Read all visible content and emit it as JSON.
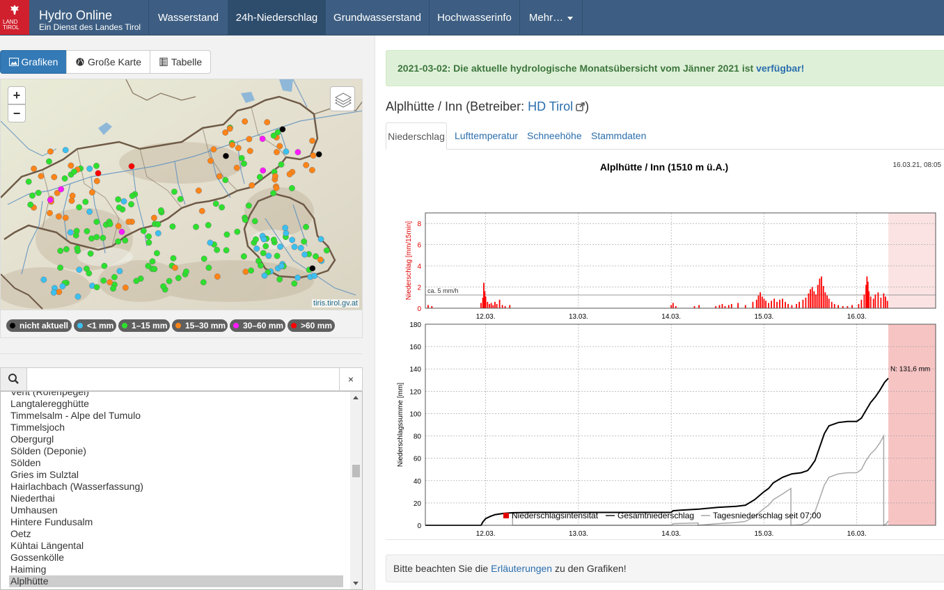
{
  "brand": {
    "logo_text": "LAND TIROL",
    "title": "Hydro Online",
    "subtitle": "Ein Dienst des Landes Tirol"
  },
  "nav": {
    "items": [
      {
        "label": "Wasserstand",
        "active": false
      },
      {
        "label": "24h-Niederschlag",
        "active": true
      },
      {
        "label": "Grundwasserstand",
        "active": false
      },
      {
        "label": "Hochwasserinfo",
        "active": false
      },
      {
        "label": "Mehr…",
        "active": false,
        "dropdown": true
      }
    ]
  },
  "view_buttons": [
    {
      "label": "Grafiken",
      "icon": "image-icon",
      "active": true
    },
    {
      "label": "Große Karte",
      "icon": "globe-icon",
      "active": false
    },
    {
      "label": "Tabelle",
      "icon": "table-icon",
      "active": false
    }
  ],
  "map": {
    "zoom_in": "+",
    "zoom_out": "−",
    "attribution": "tiris.tirol.gv.at",
    "legend": [
      {
        "label": "nicht aktuell",
        "color": "#000000"
      },
      {
        "label": "<1 mm",
        "color": "#3cc0f0"
      },
      {
        "label": "1–15 mm",
        "color": "#2ee02e"
      },
      {
        "label": "15–30 mm",
        "color": "#ff8418"
      },
      {
        "label": "30–60 mm",
        "color": "#ff19ff"
      },
      {
        "label": ">60 mm",
        "color": "#ff0000"
      }
    ]
  },
  "search": {
    "value": "",
    "placeholder": "",
    "clear": "×"
  },
  "stations": [
    "Vent (Rofenpegel)",
    "Langtaleregghütte",
    "Timmelsalm - Alpe del Tumulo",
    "Timmelsjoch",
    "Obergurgl",
    "Sölden (Deponie)",
    "Sölden",
    "Gries im Sulztal",
    "Hairlachbach (Wasserfassung)",
    "Niederthai",
    "Umhausen",
    "Hintere Fundusalm",
    "Oetz",
    "Kühtai Längental",
    "Gossenkölle",
    "Haiming",
    "Alplhütte"
  ],
  "selected_station": "Alplhütte",
  "alert": {
    "text": "2021-03-02: Die aktuelle hydrologische Monatsübersicht vom Jänner 2021 ist ",
    "link": "verfügbar!"
  },
  "station": {
    "title_prefix": "Alplhütte / Inn (Betreiber: ",
    "operator": "HD Tirol",
    "title_suffix": ")"
  },
  "tabs": [
    {
      "label": "Niederschlag",
      "active": true
    },
    {
      "label": "Lufttemperatur",
      "active": false
    },
    {
      "label": "Schneehöhe",
      "active": false
    },
    {
      "label": "Stammdaten",
      "active": false
    }
  ],
  "chart_data": [
    {
      "type": "bar",
      "title": "Alplhütte / Inn (1510 m ü.A.)",
      "timestamp": "16.03.21, 08:05",
      "ylabel": "Niederschlag [mm/15min]",
      "ylim": [
        0,
        9
      ],
      "yticks": [
        0,
        2,
        4,
        6,
        8
      ],
      "xticks": [
        "12.03.",
        "13.03.",
        "14.03.",
        "15.03.",
        "16.03."
      ],
      "xlim_days": [
        11.35,
        16.85
      ],
      "forecast_from_day": 16.34,
      "reference_line": {
        "value": 1.25,
        "label": "ca. 5 mm/h"
      },
      "series": [
        {
          "name": "Niederschlagsintensität",
          "color": "#ff0000",
          "points": [
            [
              11.38,
              0.3
            ],
            [
              11.42,
              0.2
            ],
            [
              11.95,
              0.5
            ],
            [
              11.97,
              1.0
            ],
            [
              11.98,
              2.4
            ],
            [
              11.99,
              1.6
            ],
            [
              12.0,
              1.1
            ],
            [
              12.02,
              0.6
            ],
            [
              12.04,
              0.4
            ],
            [
              12.06,
              0.5
            ],
            [
              12.08,
              0.3
            ],
            [
              12.1,
              0.6
            ],
            [
              12.12,
              0.4
            ],
            [
              12.15,
              0.8
            ],
            [
              12.18,
              0.3
            ],
            [
              12.21,
              0.2
            ],
            [
              12.26,
              0.3
            ],
            [
              14.0,
              0.3
            ],
            [
              14.02,
              0.5
            ],
            [
              14.05,
              0.2
            ],
            [
              14.25,
              0.2
            ],
            [
              14.3,
              0.3
            ],
            [
              14.48,
              0.2
            ],
            [
              14.52,
              0.3
            ],
            [
              14.55,
              0.4
            ],
            [
              14.58,
              0.2
            ],
            [
              14.62,
              0.3
            ],
            [
              14.65,
              0.4
            ],
            [
              14.72,
              0.5
            ],
            [
              14.8,
              0.3
            ],
            [
              14.88,
              0.6
            ],
            [
              14.92,
              0.8
            ],
            [
              14.94,
              1.2
            ],
            [
              14.96,
              1.5
            ],
            [
              14.98,
              1.1
            ],
            [
              15.0,
              0.9
            ],
            [
              15.02,
              0.7
            ],
            [
              15.05,
              0.5
            ],
            [
              15.08,
              0.7
            ],
            [
              15.11,
              0.9
            ],
            [
              15.14,
              0.6
            ],
            [
              15.17,
              0.8
            ],
            [
              15.2,
              0.9
            ],
            [
              15.23,
              0.6
            ],
            [
              15.26,
              0.4
            ],
            [
              15.3,
              0.3
            ],
            [
              15.35,
              0.4
            ],
            [
              15.38,
              0.6
            ],
            [
              15.42,
              0.8
            ],
            [
              15.45,
              1.0
            ],
            [
              15.48,
              1.4
            ],
            [
              15.5,
              1.8
            ],
            [
              15.52,
              2.0
            ],
            [
              15.54,
              1.6
            ],
            [
              15.56,
              1.3
            ],
            [
              15.58,
              2.2
            ],
            [
              15.6,
              2.8
            ],
            [
              15.62,
              3.0
            ],
            [
              15.64,
              2.1
            ],
            [
              15.66,
              1.5
            ],
            [
              15.68,
              1.2
            ],
            [
              15.7,
              0.9
            ],
            [
              15.73,
              0.6
            ],
            [
              15.76,
              0.4
            ],
            [
              15.8,
              0.3
            ],
            [
              15.85,
              0.2
            ],
            [
              15.9,
              0.2
            ],
            [
              15.95,
              0.3
            ],
            [
              16.02,
              0.4
            ],
            [
              16.05,
              0.8
            ],
            [
              16.08,
              1.3
            ],
            [
              16.1,
              2.2
            ],
            [
              16.11,
              3.0
            ],
            [
              16.12,
              2.5
            ],
            [
              16.13,
              1.6
            ],
            [
              16.15,
              1.1
            ],
            [
              16.18,
              0.9
            ],
            [
              16.2,
              1.3
            ],
            [
              16.23,
              1.5
            ],
            [
              16.26,
              1.0
            ],
            [
              16.29,
              1.4
            ],
            [
              16.31,
              1.1
            ],
            [
              16.33,
              0.7
            ]
          ]
        }
      ]
    },
    {
      "type": "line",
      "ylabel": "Niederschlagssumme [mm]",
      "ylim": [
        0,
        180
      ],
      "yticks": [
        0,
        20,
        40,
        60,
        80,
        100,
        120,
        140,
        160,
        180
      ],
      "xticks": [
        "12.03.",
        "13.03.",
        "14.03.",
        "15.03.",
        "16.03."
      ],
      "xlim_days": [
        11.35,
        16.85
      ],
      "forecast_from_day": 16.34,
      "end_label": "N: 131,6 mm",
      "series": [
        {
          "name": "Gesamtniederschlag",
          "color": "#000000",
          "points": [
            [
              11.35,
              0
            ],
            [
              11.95,
              0
            ],
            [
              11.97,
              3
            ],
            [
              12.0,
              6
            ],
            [
              12.05,
              8
            ],
            [
              12.1,
              9.5
            ],
            [
              12.2,
              10.8
            ],
            [
              12.3,
              11.3
            ],
            [
              12.5,
              11.5
            ],
            [
              13.0,
              11.5
            ],
            [
              13.5,
              11.5
            ],
            [
              14.0,
              11.6
            ],
            [
              14.02,
              13
            ],
            [
              14.1,
              13.5
            ],
            [
              14.3,
              14.5
            ],
            [
              14.5,
              16
            ],
            [
              14.7,
              17
            ],
            [
              14.8,
              18
            ],
            [
              14.9,
              23
            ],
            [
              15.0,
              30
            ],
            [
              15.05,
              33
            ],
            [
              15.1,
              38
            ],
            [
              15.2,
              43
            ],
            [
              15.3,
              46
            ],
            [
              15.4,
              47
            ],
            [
              15.47,
              49
            ],
            [
              15.5,
              52
            ],
            [
              15.55,
              58
            ],
            [
              15.6,
              70
            ],
            [
              15.65,
              82
            ],
            [
              15.7,
              89
            ],
            [
              15.8,
              92
            ],
            [
              15.9,
              93
            ],
            [
              16.0,
              93
            ],
            [
              16.05,
              96
            ],
            [
              16.1,
              103
            ],
            [
              16.15,
              110
            ],
            [
              16.2,
              115
            ],
            [
              16.25,
              121
            ],
            [
              16.3,
              128
            ],
            [
              16.34,
              131.6
            ]
          ]
        },
        {
          "name": "Tagesniederschlag seit 07:00",
          "color": "#a8a8a8",
          "points": [
            [
              11.35,
              0
            ],
            [
              11.95,
              0
            ],
            [
              11.97,
              3
            ],
            [
              12.0,
              6
            ],
            [
              12.05,
              8
            ],
            [
              12.1,
              9.5
            ],
            [
              12.2,
              10.8
            ],
            [
              12.29,
              11.2
            ],
            [
              12.29,
              0
            ],
            [
              14.0,
              0
            ],
            [
              14.02,
              1.5
            ],
            [
              14.29,
              2.1
            ],
            [
              14.29,
              0
            ],
            [
              14.5,
              1.5
            ],
            [
              14.7,
              2.5
            ],
            [
              14.8,
              3.5
            ],
            [
              14.9,
              8
            ],
            [
              15.0,
              15
            ],
            [
              15.05,
              18
            ],
            [
              15.1,
              23
            ],
            [
              15.2,
              28
            ],
            [
              15.29,
              33
            ],
            [
              15.29,
              0
            ],
            [
              15.4,
              0.5
            ],
            [
              15.47,
              3
            ],
            [
              15.5,
              6
            ],
            [
              15.55,
              12
            ],
            [
              15.6,
              24
            ],
            [
              15.65,
              36
            ],
            [
              15.7,
              43
            ],
            [
              15.8,
              46
            ],
            [
              15.9,
              47
            ],
            [
              16.0,
              47
            ],
            [
              16.05,
              50
            ],
            [
              16.1,
              58
            ],
            [
              16.15,
              64
            ],
            [
              16.2,
              68
            ],
            [
              16.25,
              74
            ],
            [
              16.29,
              80
            ],
            [
              16.29,
              0
            ],
            [
              16.32,
              1.5
            ],
            [
              16.34,
              4
            ]
          ]
        }
      ]
    }
  ],
  "note": {
    "before": "Bitte beachten Sie die ",
    "link": "Erläuterungen",
    "after": " zu den Grafiken!"
  }
}
